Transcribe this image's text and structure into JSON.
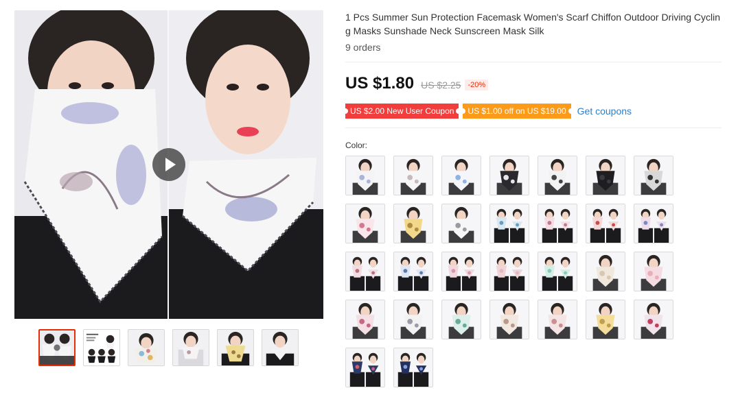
{
  "product": {
    "title": "1 Pcs Summer Sun Protection Facemask Women's Scarf Chiffon Outdoor Driving Cycling Masks Sunshade Neck Sunscreen Mask Silk",
    "orders": "9 orders"
  },
  "price": {
    "current": "US $1.80",
    "original": "US $2.25",
    "discount": "-20%"
  },
  "coupons": {
    "new_user": "US $2.00 New User Coupon",
    "store": "US $1.00 off on US $19.00",
    "get_label": "Get coupons"
  },
  "colors": {
    "accent_red": "#e62e04",
    "coupon_red": "#f23d3d",
    "coupon_orange": "#fb9b19",
    "link_blue": "#2e7fc6"
  },
  "gallery": {
    "play_icon": "play-icon",
    "active_thumbnail": 1,
    "thumbnail_count": 6
  },
  "variants": {
    "label": "Color:",
    "count": 30,
    "options": [
      "white-blue-floral",
      "white-floral",
      "light-blue-floral",
      "black-white-floral",
      "white-black-print",
      "black-solid",
      "black-white-stripe",
      "pink-floral",
      "yellow-floral",
      "white-dots",
      "blue-print-pair",
      "pink-print-pair",
      "red-print-pair",
      "mixed-print-pair",
      "pink-print-pair-2",
      "blue-print-pair-2",
      "pink-pair",
      "pink-solid-pair",
      "mint-pair",
      "beige-solid",
      "pink-solid",
      "pink-floral-2",
      "white-print",
      "mint-print",
      "beige-floral",
      "pink-beige-floral",
      "yellow-print",
      "blue-red-floral",
      "navy-floral-pair",
      "navy-print-pair"
    ]
  }
}
